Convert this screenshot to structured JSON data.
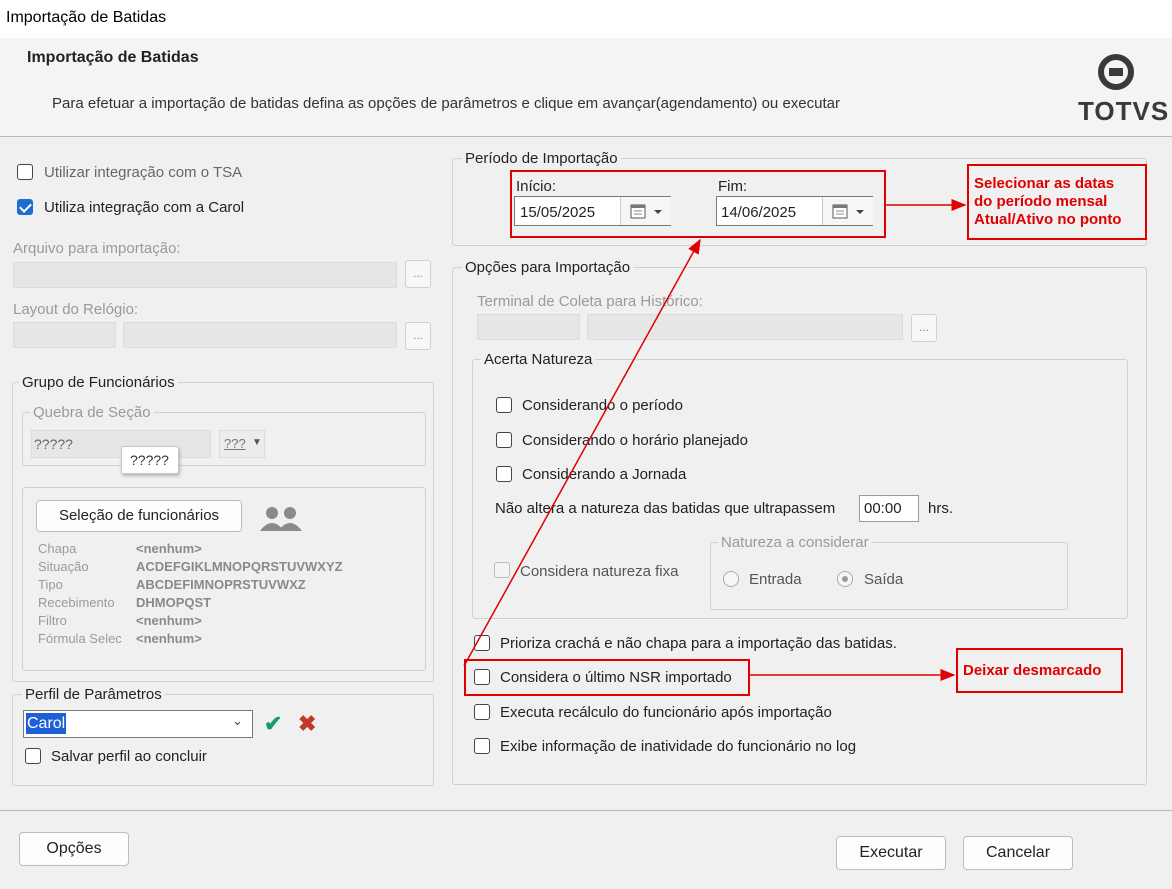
{
  "window": {
    "title": "Importação de Batidas"
  },
  "header": {
    "title": "Importação de Batidas",
    "description": "Para efetuar a importação de batidas defina as opções de parâmetros e clique em avançar(agendamento) ou executar",
    "logo_text": "TOTVS"
  },
  "left": {
    "tsa_label": "Utilizar integração com o TSA",
    "carol_label": "Utiliza integração com a Carol",
    "arquivo_label": "Arquivo para importação:",
    "layout_label": "Layout do Relógio:",
    "browse": "...",
    "grupo": {
      "title": "Grupo de Funcionários",
      "quebra_label": "Quebra de Seção",
      "quebra_value": "?????",
      "tooltip": "?????",
      "icon_text": "???",
      "selecao_button": "Seleção de funcionários",
      "info": [
        {
          "label": "Chapa",
          "value": "<nenhum>"
        },
        {
          "label": "Situação",
          "value": "ACDEFGIKLMNOPQRSTUVWXYZ"
        },
        {
          "label": "Tipo",
          "value": "ABCDEFIMNOPRSTUVWXZ"
        },
        {
          "label": "Recebimento",
          "value": "DHMOPQST"
        },
        {
          "label": "Filtro",
          "value": "<nenhum>"
        },
        {
          "label": "Fórmula Selec",
          "value": "<nenhum>"
        }
      ]
    },
    "perfil": {
      "title": "Perfil de Parâmetros",
      "value": "Carol",
      "salvar_label": "Salvar perfil ao concluir"
    }
  },
  "periodo": {
    "title": "Período de Importação",
    "inicio_label": "Início:",
    "inicio_value": "15/05/2025",
    "fim_label": "Fim:",
    "fim_value": "14/06/2025"
  },
  "opcoes": {
    "title": "Opções para Importação",
    "terminal_label": "Terminal de Coleta para Histórico:",
    "browse": "...",
    "acerta": {
      "title": "Acerta Natureza",
      "opt1": "Considerando o período",
      "opt2": "Considerando o horário planejado",
      "opt3": "Considerando a Jornada",
      "nao_altera": "Não altera a natureza das batidas que ultrapassem",
      "hours_value": "00:00",
      "hrs": "hrs.",
      "fixa_label": "Considera natureza fixa",
      "natureza_title": "Natureza a considerar",
      "entrada": "Entrada",
      "saida": "Saída"
    },
    "prioriza": "Prioriza crachá e não chapa para a importação das batidas.",
    "ultimo_nsr": "Considera o último NSR importado",
    "recalculo": "Executa recálculo do funcionário após importação",
    "inatividade": "Exibe informação de inatividade do funcionário no log"
  },
  "annotations": {
    "note1": [
      "Selecionar as datas",
      "do período mensal",
      "Atual/Ativo no ponto"
    ],
    "note2": "Deixar desmarcado",
    "color": "#e00000"
  },
  "footer": {
    "opcoes": "Opções",
    "executar": "Executar",
    "cancelar": "Cancelar"
  },
  "colors": {
    "accent": "#1a6fcf",
    "annotation": "#e00000",
    "selection": "#1e5fd6"
  }
}
